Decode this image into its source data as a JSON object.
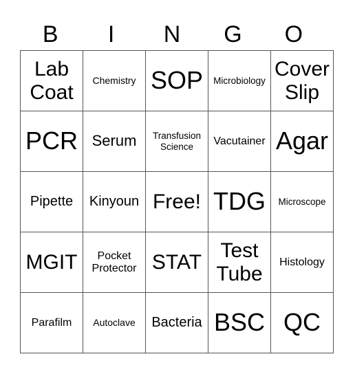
{
  "header": {
    "letters": [
      "B",
      "I",
      "N",
      "G",
      "O"
    ]
  },
  "card": {
    "rows": [
      [
        {
          "text": "Lab Coat",
          "size": "l"
        },
        {
          "text": "Chemistry",
          "size": "xs"
        },
        {
          "text": "SOP",
          "size": "xl"
        },
        {
          "text": "Microbiology",
          "size": "xxs"
        },
        {
          "text": "Cover Slip",
          "size": "l"
        }
      ],
      [
        {
          "text": "PCR",
          "size": "xl"
        },
        {
          "text": "Serum",
          "size": "m"
        },
        {
          "text": "Transfusion Science",
          "size": "xxs"
        },
        {
          "text": "Vacutainer",
          "size": "s"
        },
        {
          "text": "Agar",
          "size": "xl"
        }
      ],
      [
        {
          "text": "Pipette",
          "size": "sm"
        },
        {
          "text": "Kinyoun",
          "size": "sm"
        },
        {
          "text": "Free!",
          "size": "l"
        },
        {
          "text": "TDG",
          "size": "xl"
        },
        {
          "text": "Microscope",
          "size": "xxs"
        }
      ],
      [
        {
          "text": "MGIT",
          "size": "l"
        },
        {
          "text": "Pocket Protector",
          "size": "s"
        },
        {
          "text": "STAT",
          "size": "l"
        },
        {
          "text": "Test Tube",
          "size": "l"
        },
        {
          "text": "Histology",
          "size": "s"
        }
      ],
      [
        {
          "text": "Parafilm",
          "size": "s"
        },
        {
          "text": "Autoclave",
          "size": "xs"
        },
        {
          "text": "Bacteria",
          "size": "sm"
        },
        {
          "text": "BSC",
          "size": "xl"
        },
        {
          "text": "QC",
          "size": "xl"
        }
      ]
    ]
  }
}
